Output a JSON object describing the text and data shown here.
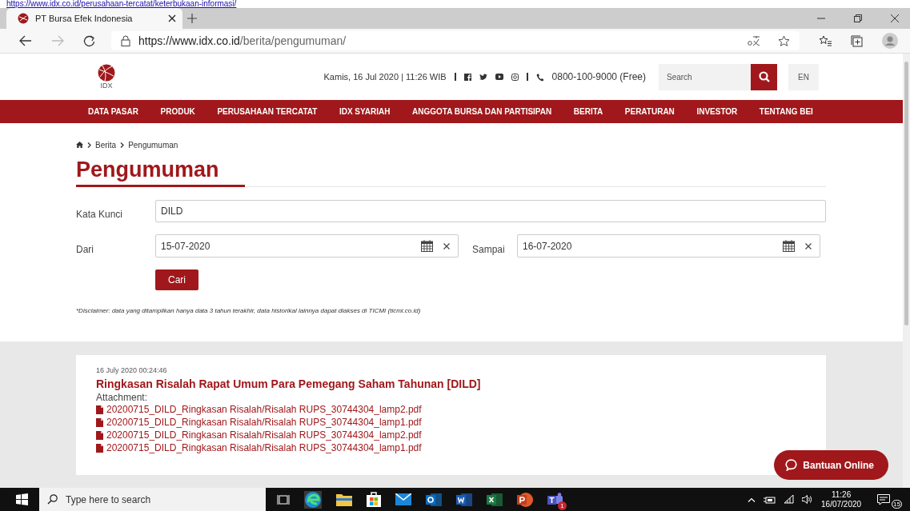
{
  "top_link": "https://www.idx.co.id/perusahaan-tercatat/keterbukaan-informasi/",
  "browser": {
    "tab_title": "PT Bursa Efek Indonesia",
    "url_host": "https://www.idx.co.id",
    "url_path": "/berita/pengumuman/"
  },
  "header": {
    "logo_text": "IDX",
    "datetime": "Kamis, 16 Jul 2020 | 11:26 WIB",
    "phone": "0800-100-9000 (Free)",
    "search_placeholder": "Search",
    "language": "EN"
  },
  "nav": [
    "DATA PASAR",
    "PRODUK",
    "PERUSAHAAN TERCATAT",
    "IDX SYARIAH",
    "ANGGOTA BURSA DAN PARTISIPAN",
    "BERITA",
    "PERATURAN",
    "INVESTOR",
    "TENTANG BEI"
  ],
  "breadcrumb": [
    "Berita",
    "Pengumuman"
  ],
  "title": "Pengumuman",
  "form": {
    "keyword_label": "Kata Kunci",
    "keyword": "DILD",
    "from_label": "Dari",
    "from": "15-07-2020",
    "to_label": "Sampai",
    "to": "16-07-2020",
    "button": "Cari",
    "disclaimer": "*Disclaimer: data yang ditampilkan hanya data 3 tahun terakhir, data historikal lainnya dapat diakses di TICMI (ticmi.co.id)"
  },
  "results": [
    {
      "timestamp": "16 July 2020 00:24:46",
      "title": "Ringkasan Risalah Rapat Umum Para Pemegang Saham Tahunan [DILD]",
      "attachment_label": "Attachment:",
      "attachments": [
        "20200715_DILD_Ringkasan Risalah/Risalah RUPS_30744304_lamp2.pdf",
        "20200715_DILD_Ringkasan Risalah/Risalah RUPS_30744304_lamp1.pdf",
        "20200715_DILD_Ringkasan Risalah/Risalah RUPS_30744304_lamp2.pdf",
        "20200715_DILD_Ringkasan Risalah/Risalah RUPS_30744304_lamp1.pdf"
      ]
    }
  ],
  "chat_button": "Bantuan Online",
  "taskbar": {
    "search_placeholder": "Type here to search",
    "teams_badge": "1",
    "time": "11:26",
    "date": "16/07/2020",
    "notifications": "15"
  }
}
